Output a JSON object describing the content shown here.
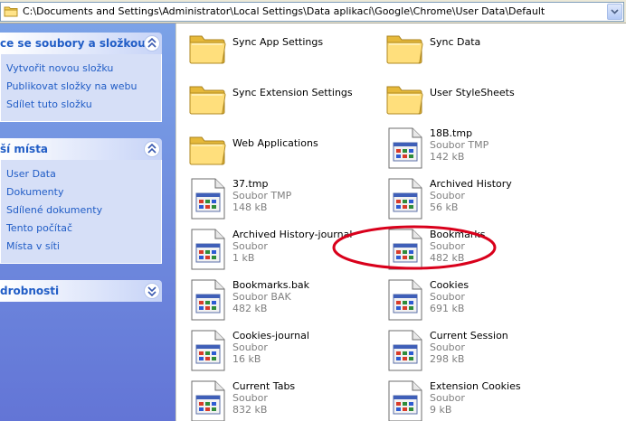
{
  "address": {
    "path": "C:\\Documents and Settings\\Administrator\\Local Settings\\Data aplikací\\Google\\Chrome\\User Data\\Default"
  },
  "taskpane": {
    "file_tasks": {
      "title": "ce se soubory a složkou",
      "links": [
        "Vytvořit novou složku",
        "Publikovat složky na webu",
        "Sdílet tuto složku"
      ]
    },
    "other_places": {
      "title": "ší místa",
      "links": [
        "User Data",
        "Dokumenty",
        "Sdílené dokumenty",
        "Tento počítač",
        "Místa v síti"
      ]
    },
    "details": {
      "title": "drobnosti"
    }
  },
  "files": [
    {
      "name": "Sync App Settings",
      "kind": "folder"
    },
    {
      "name": "Sync Data",
      "kind": "folder"
    },
    {
      "name": "Sync Extension Settings",
      "kind": "folder"
    },
    {
      "name": "User StyleSheets",
      "kind": "folder"
    },
    {
      "name": "Web Applications",
      "kind": "folder"
    },
    {
      "name": "18B.tmp",
      "type": "Soubor TMP",
      "size": "142 kB",
      "kind": "file"
    },
    {
      "name": "37.tmp",
      "type": "Soubor TMP",
      "size": "148 kB",
      "kind": "file"
    },
    {
      "name": "Archived History",
      "type": "Soubor",
      "size": "56 kB",
      "kind": "file"
    },
    {
      "name": "Archived History-journal",
      "type": "Soubor",
      "size": "1 kB",
      "kind": "file"
    },
    {
      "name": "Bookmarks",
      "type": "Soubor",
      "size": "482 kB",
      "kind": "file"
    },
    {
      "name": "Bookmarks.bak",
      "type": "Soubor BAK",
      "size": "482 kB",
      "kind": "file"
    },
    {
      "name": "Cookies",
      "type": "Soubor",
      "size": "691 kB",
      "kind": "file"
    },
    {
      "name": "Cookies-journal",
      "type": "Soubor",
      "size": "16 kB",
      "kind": "file"
    },
    {
      "name": "Current Session",
      "type": "Soubor",
      "size": "298 kB",
      "kind": "file"
    },
    {
      "name": "Current Tabs",
      "type": "Soubor",
      "size": "832 kB",
      "kind": "file"
    },
    {
      "name": "Extension Cookies",
      "type": "Soubor",
      "size": "9 kB",
      "kind": "file"
    }
  ],
  "colors": {
    "annotation": "#d9001b",
    "link": "#215dc6",
    "pane_top": "#7ba2e7",
    "pane_bottom": "#6375d6"
  }
}
